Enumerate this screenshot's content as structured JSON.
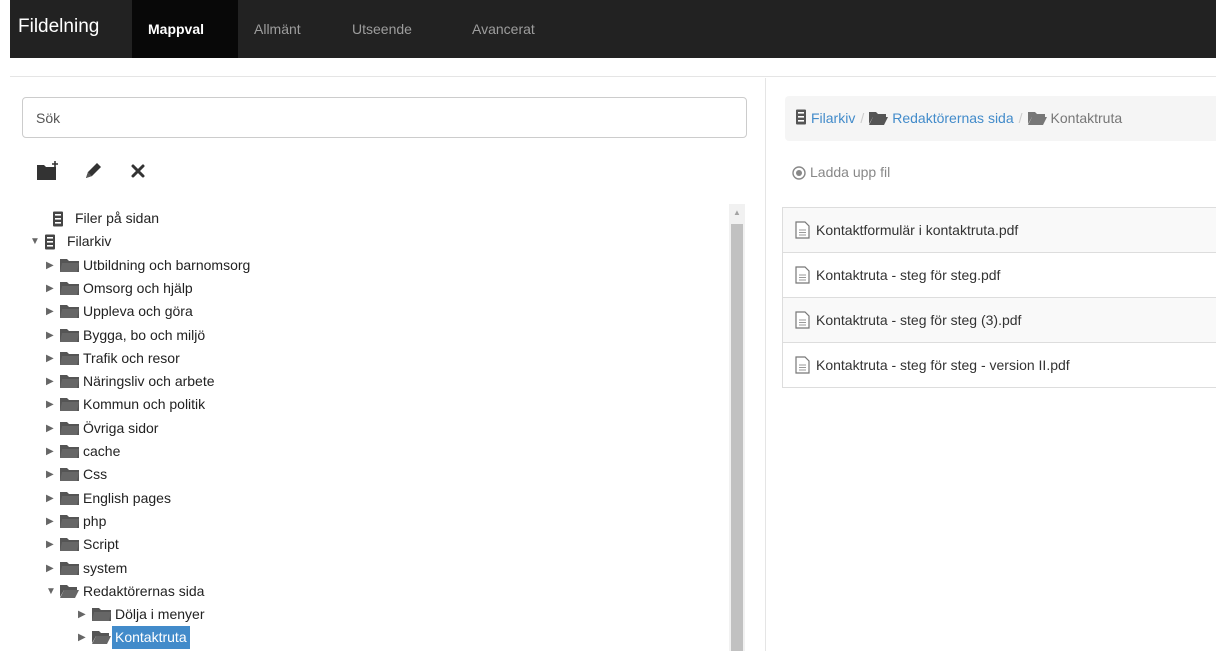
{
  "app": {
    "title": "Fildelning"
  },
  "tabs": [
    {
      "label": "Mappval",
      "active": true
    },
    {
      "label": "Allmänt",
      "active": false
    },
    {
      "label": "Utseende",
      "active": false
    },
    {
      "label": "Avancerat",
      "active": false
    }
  ],
  "search": {
    "placeholder": "Sök"
  },
  "toolbar": {
    "icons": [
      "new-folder-icon",
      "pencil-icon",
      "close-icon"
    ]
  },
  "tree": [
    {
      "label": "Filer på sidan",
      "icon": "archive-icon",
      "arrow": ""
    },
    {
      "label": "Filarkiv",
      "icon": "archive-icon",
      "arrow": "▼"
    },
    {
      "label": "Utbildning och barnomsorg",
      "icon": "folder-icon",
      "arrow": "▶"
    },
    {
      "label": "Omsorg och hjälp",
      "icon": "folder-icon",
      "arrow": "▶"
    },
    {
      "label": "Uppleva och göra",
      "icon": "folder-icon",
      "arrow": "▶"
    },
    {
      "label": "Bygga, bo och miljö",
      "icon": "folder-icon",
      "arrow": "▶"
    },
    {
      "label": "Trafik och resor",
      "icon": "folder-icon",
      "arrow": "▶"
    },
    {
      "label": "Näringsliv och arbete",
      "icon": "folder-icon",
      "arrow": "▶"
    },
    {
      "label": "Kommun och politik",
      "icon": "folder-icon",
      "arrow": "▶"
    },
    {
      "label": "Övriga sidor",
      "icon": "folder-icon",
      "arrow": "▶"
    },
    {
      "label": "cache",
      "icon": "folder-icon",
      "arrow": "▶"
    },
    {
      "label": "Css",
      "icon": "folder-icon",
      "arrow": "▶"
    },
    {
      "label": "English pages",
      "icon": "folder-icon",
      "arrow": "▶"
    },
    {
      "label": "php",
      "icon": "folder-icon",
      "arrow": "▶"
    },
    {
      "label": "Script",
      "icon": "folder-icon",
      "arrow": "▶"
    },
    {
      "label": "system",
      "icon": "folder-icon",
      "arrow": "▶"
    },
    {
      "label": "Redaktörernas sida",
      "icon": "folder-open-icon",
      "arrow": "▼"
    },
    {
      "label": "Dölja i menyer",
      "icon": "folder-icon",
      "arrow": "▶"
    },
    {
      "label": "Kontaktruta",
      "icon": "folder-open-icon",
      "arrow": "▶",
      "selected": true
    }
  ],
  "breadcrumb": [
    {
      "label": "Filarkiv",
      "icon": "archive-icon"
    },
    {
      "label": "Redaktörernas sida",
      "icon": "folder-open-icon"
    },
    {
      "label": "Kontaktruta",
      "icon": "folder-open-icon"
    }
  ],
  "breadcrumb_separator": "/",
  "upload": {
    "label": "Ladda upp fil"
  },
  "files": [
    {
      "name": "Kontaktformulär i kontaktruta.pdf"
    },
    {
      "name": "Kontaktruta - steg för steg.pdf"
    },
    {
      "name": "Kontaktruta - steg för steg (3).pdf"
    },
    {
      "name": "Kontaktruta - steg för steg - version II.pdf"
    }
  ],
  "colors": {
    "navbar": "#222222",
    "active_tab": "#080808",
    "link": "#428bca",
    "selected": "#428bca"
  }
}
